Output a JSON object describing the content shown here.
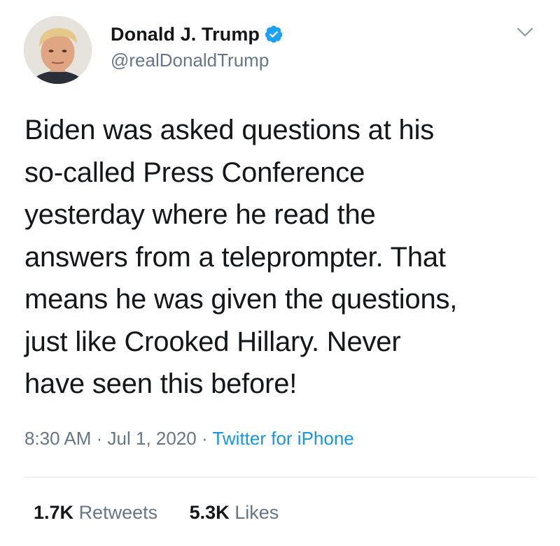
{
  "author": {
    "name": "Donald J. Trump",
    "handle": "@realDonaldTrump",
    "verified": true
  },
  "tweet": {
    "text": "Biden was asked questions at his\nso-called Press Conference\nyesterday where he read the\nanswers from a teleprompter. That\nmeans he was given the questions,\njust like Crooked Hillary. Never\nhave seen this before!"
  },
  "meta": {
    "time": "8:30 AM",
    "separator": "·",
    "date": "Jul 1, 2020",
    "source": "Twitter for iPhone"
  },
  "stats": {
    "retweets_count": "1.7K",
    "retweets_label": "Retweets",
    "likes_count": "5.3K",
    "likes_label": "Likes"
  },
  "icons": {
    "verified": "verified-badge-icon",
    "more": "chevron-down-icon"
  },
  "colors": {
    "text": "#14171a",
    "secondary": "#657786",
    "accent": "#1b95e0",
    "divider": "#e1e8ed"
  }
}
